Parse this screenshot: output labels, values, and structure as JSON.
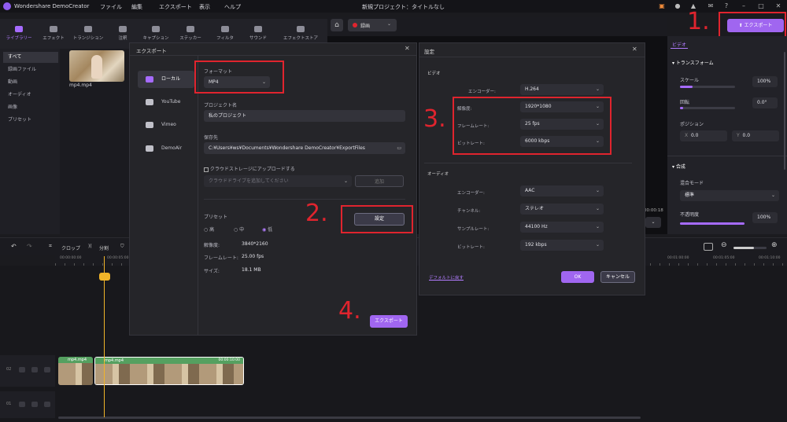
{
  "app": {
    "title": "Wondershare DemoCreator",
    "project_title": "新規プロジェクト：タイトルなし"
  },
  "menu": [
    "ファイル",
    "編集",
    "エクスポート",
    "表示",
    "ヘルプ"
  ],
  "top_export_button": "エクスポート",
  "library": {
    "tabs": [
      "ライブラリー",
      "エフェクト",
      "トランジション",
      "注釈",
      "キャプション",
      "ステッカー",
      "フィルタ",
      "サウンド",
      "エフェクトストア"
    ],
    "side_items": [
      "すべて",
      "録画ファイル",
      "動画",
      "オーディオ",
      "画像",
      "プリセット"
    ],
    "media_name": "mp4.mp4"
  },
  "preview": {
    "record_label": "録画",
    "timecode": "00:00:18"
  },
  "properties": {
    "tab": "ビデオ",
    "transform_header": "トランスフォーム",
    "scale_label": "スケール",
    "scale_value": "100%",
    "rotate_label": "回転",
    "rotate_value": "0.0°",
    "position_label": "ポジション",
    "pos_x_label": "X",
    "pos_x": "0.0",
    "pos_y_label": "Y",
    "pos_y": "0.0",
    "composite_header": "合成",
    "blend_label": "混合モード",
    "blend_value": "標準",
    "opacity_label": "不透明度",
    "opacity_value": "100%"
  },
  "timeline": {
    "crop_label": "クロップ",
    "split_label": "分割",
    "ruler_ticks": [
      "00:00:00:00",
      "00:00:05:00",
      "00:01:00:00",
      "00:01:05:00",
      "00:01:10:00"
    ],
    "clip1_label": "mp4.mp4",
    "clip2_label": "mp4.mp4",
    "clip2_time": "00:00:10:00",
    "track2_num": "02",
    "track1_num": "01"
  },
  "export_dialog": {
    "title": "エクスポート",
    "nav": [
      "ローカル",
      "YouTube",
      "Vimeo",
      "DemoAir"
    ],
    "format_label": "フォーマット",
    "format_value": "MP4",
    "project_name_label": "プロジェクト名",
    "project_name": "私のプロジェクト",
    "save_to_label": "保存先",
    "save_to": "C:¥Users¥ws¥Documents¥Wondershare DemoCreator¥ExportFiles",
    "cloud_checkbox": "クラウドストレージにアップロードする",
    "cloud_placeholder": "クラウドドライブを追加してください",
    "add_button": "追加",
    "preset_label": "プリセット",
    "presets": [
      "高",
      "中",
      "低"
    ],
    "settings_button": "設定",
    "resolution_label": "解像度:",
    "resolution": "3840*2160",
    "framerate_label": "フレームレート:",
    "framerate": "25.00 fps",
    "size_label": "サイズ:",
    "size": "18.1 MB",
    "export_button": "エクスポート"
  },
  "settings_dialog": {
    "title": "設定",
    "video_header": "ビデオ",
    "v_encoder_label": "エンコーダー:",
    "v_encoder": "H.264",
    "resolution_label": "解像度:",
    "resolution": "1920*1080",
    "framerate_label": "フレームレート:",
    "framerate": "25 fps",
    "bitrate_label": "ビットレート:",
    "bitrate": "6000 kbps",
    "audio_header": "オーディオ",
    "a_encoder_label": "エンコーダー:",
    "a_encoder": "AAC",
    "channel_label": "チャンネル:",
    "channel": "ステレオ",
    "sample_label": "サンプルレート:",
    "sample": "44100 Hz",
    "a_bitrate_label": "ビットレート:",
    "a_bitrate": "192 kbps",
    "default_link": "デフォルトに戻す",
    "ok_button": "OK",
    "cancel_button": "キャンセル"
  },
  "annotations": [
    "1.",
    "2.",
    "3.",
    "4."
  ],
  "colors": {
    "accent": "#a066f0",
    "annotation_red": "#e0242e",
    "playhead": "#f0b429"
  }
}
